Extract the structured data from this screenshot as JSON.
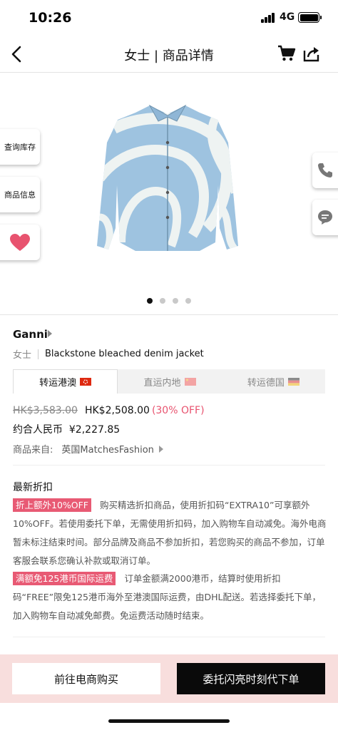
{
  "status": {
    "time": "10:26",
    "network": "4G"
  },
  "nav": {
    "title": "女士 | 商品详情"
  },
  "side_tabs": {
    "stock": "查询库存",
    "info": "商品信息"
  },
  "gallery": {
    "page_count": 4,
    "active_index": 0
  },
  "product": {
    "brand": "Ganni",
    "gender": "女士",
    "name": "Blackstone bleached denim jacket"
  },
  "shipping_tabs": [
    {
      "label": "转运港澳",
      "active": true
    },
    {
      "label": "直运内地",
      "active": false
    },
    {
      "label": "转运德国",
      "active": false
    }
  ],
  "pricing": {
    "original": "HK$3,583.00",
    "current": "HK$2,508.00",
    "discount": "(30% OFF)",
    "rmb": "约合人民币  ¥2,227.85",
    "source_label": "商品来自:",
    "source_value": "英国MatchesFashion"
  },
  "promotions": {
    "title": "最新折扣",
    "items": [
      {
        "tag": "折上额外10%OFF",
        "text": "购买精选折扣商品，使用折扣码“EXTRA10”可享额外10%OFF。若使用委托下单，无需使用折扣码，加入购物车自动减免。海外电商暂未标注结束时间。部分品牌及商品不参加折扣，若您购买的商品不参加，订单客服会联系您确认补款或取消订单。"
      },
      {
        "tag": "满额免125港币国际运费",
        "text": "订单金额满2000港币，结算时使用折扣码“FREE”限免125港币海外至港澳国际运费，由DHL配送。若选择委托下单，加入购物车自动减免邮费。免运费活动随时结束。"
      }
    ]
  },
  "actions": {
    "buy_online": "前往电商购买",
    "delegate_order": "委托闪亮时刻代下单"
  },
  "colors": {
    "accent": "#e85a74",
    "bottom_bg": "#f8dedd"
  },
  "icons": [
    "back-icon",
    "cart-icon",
    "share-icon",
    "heart-icon",
    "phone-icon",
    "chat-icon"
  ]
}
